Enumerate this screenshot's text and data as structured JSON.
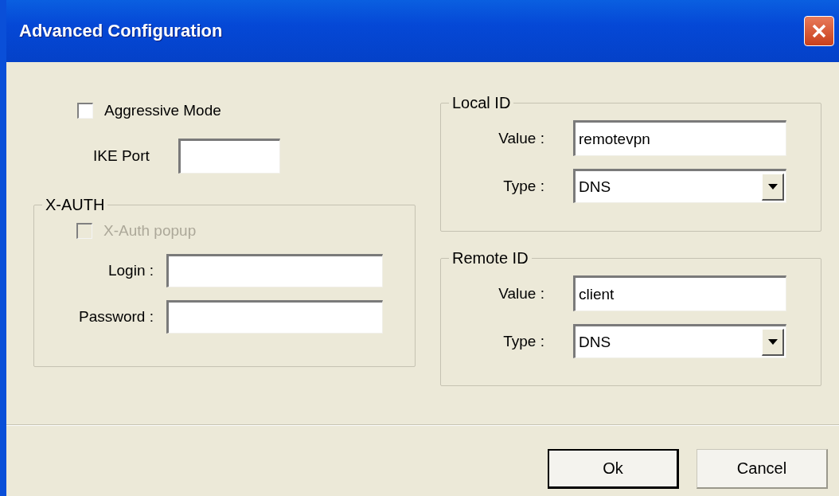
{
  "window": {
    "title": "Advanced Configuration"
  },
  "aggressive_mode": {
    "label": "Aggressive Mode",
    "checked": false
  },
  "ike_port": {
    "label": "IKE Port"
  },
  "x_auth": {
    "title": "X-AUTH",
    "popup": {
      "label": "X-Auth popup",
      "checked": false,
      "disabled": true
    },
    "login": {
      "label": "Login :"
    },
    "password": {
      "label": "Password :"
    }
  },
  "local_id": {
    "title": "Local ID",
    "value_label": "Value :",
    "value": "remotevpn",
    "type_label": "Type :",
    "type": "DNS"
  },
  "remote_id": {
    "title": "Remote ID",
    "value_label": "Value :",
    "value": "client",
    "type_label": "Type :",
    "type": "DNS"
  },
  "buttons": [
    {
      "label": "Ok",
      "default": true
    },
    {
      "label": "Cancel",
      "default": false
    }
  ]
}
